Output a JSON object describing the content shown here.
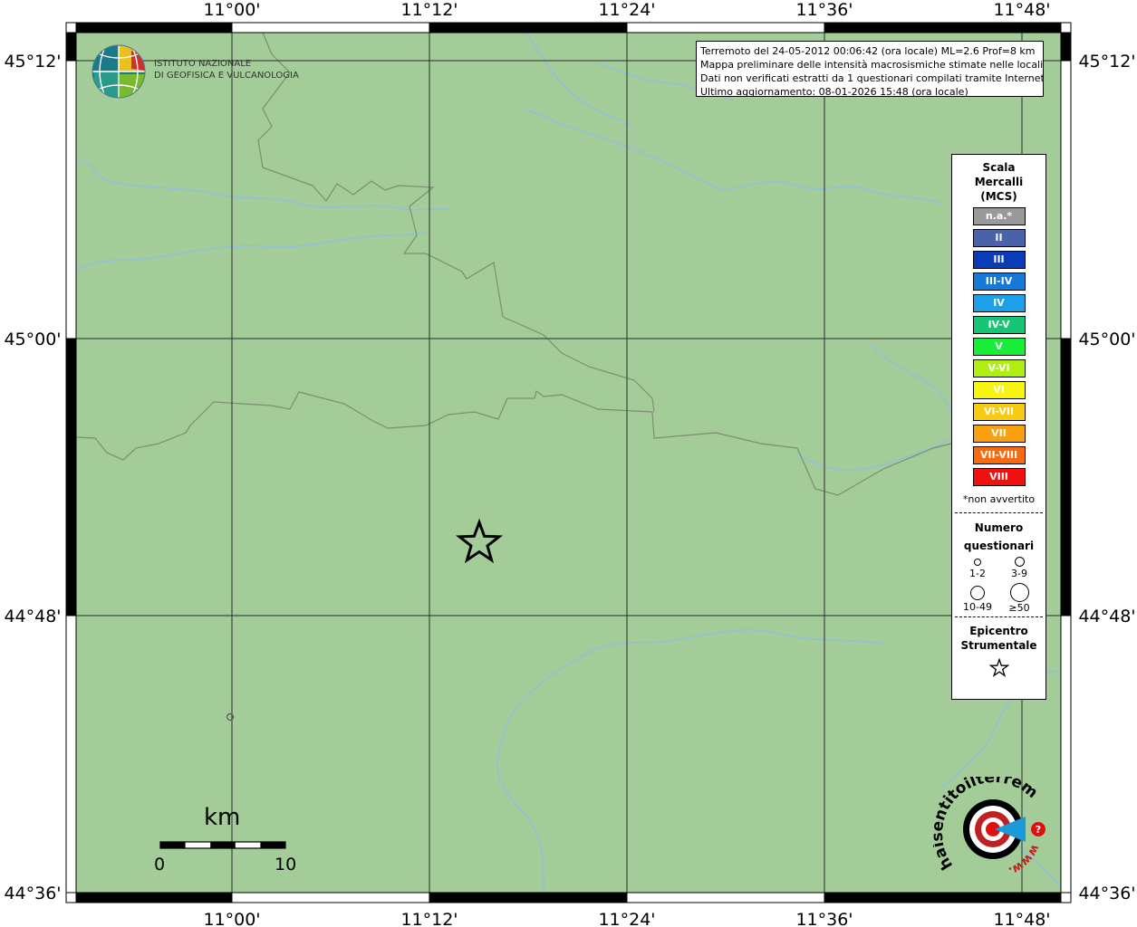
{
  "map": {
    "lon_ticks": [
      "11°00'",
      "11°12'",
      "11°24'",
      "11°36'",
      "11°48'"
    ],
    "lat_ticks": [
      "45°12'",
      "45°00'",
      "44°48'",
      "44°36'"
    ],
    "colors": {
      "land": "#a3cc98",
      "river": "#92c0d8",
      "border": "#7c8e74",
      "grid": "#2a2a2a"
    },
    "epicenter_icon": "star-icon",
    "questionnaire_marker": "small-circle-icon"
  },
  "info": {
    "line1": "Terremoto del 24-05-2012 00:06:42 (ora locale) ML=2.6 Prof=8 km",
    "line2": "Mappa preliminare delle intensità macrosismiche stimate nelle località",
    "line3": "Dati non verificati estratti da 1 questionari compilati tramite Internet.",
    "line4": "Ultimo aggiornamento: 08-01-2026 15:48 (ora locale)"
  },
  "legend": {
    "scale_title": [
      "Scala",
      "Mercalli",
      "(MCS)"
    ],
    "scale": [
      {
        "label": "n.a.*",
        "color": "#999999"
      },
      {
        "label": "II",
        "color": "#4a62a8"
      },
      {
        "label": "III",
        "color": "#0a3cb8"
      },
      {
        "label": "III-IV",
        "color": "#1678d8"
      },
      {
        "label": "IV",
        "color": "#1ca0e8"
      },
      {
        "label": "IV-V",
        "color": "#16c476"
      },
      {
        "label": "V",
        "color": "#18ee3a"
      },
      {
        "label": "V-VI",
        "color": "#b0ee10"
      },
      {
        "label": "VI",
        "color": "#f8f410"
      },
      {
        "label": "VI-VII",
        "color": "#f8ca10"
      },
      {
        "label": "VII",
        "color": "#f8a010"
      },
      {
        "label": "VII-VIII",
        "color": "#f86a10"
      },
      {
        "label": "VIII",
        "color": "#f01010"
      }
    ],
    "not_felt_note": "*non avvertito",
    "questionnaires_title": [
      "Numero",
      "questionari"
    ],
    "questionnaire_sizes": [
      "1-2",
      "3-9",
      "10-49",
      "≥50"
    ],
    "epicenter_title": [
      "Epicentro",
      "Strumentale"
    ]
  },
  "logos": {
    "ingv_line1": "ISTITUTO NAZIONALE",
    "ingv_line2": "DI GEOFISICA E VULCANOLOGIA",
    "hst_text": "haisentitoilterremoto.it",
    "hst_url": "www."
  },
  "scale_bar": {
    "unit": "km",
    "start": "0",
    "end": "10"
  }
}
